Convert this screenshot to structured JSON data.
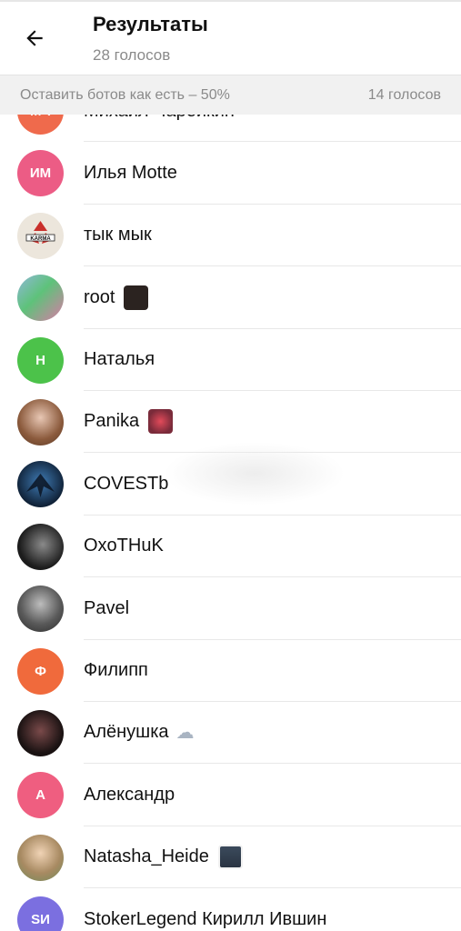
{
  "header": {
    "title": "Результаты",
    "subtitle": "28 голосов",
    "back_icon": "arrow-left-icon"
  },
  "section": {
    "option_label": "Оставить ботов как есть – 50%",
    "votes": "14 голосов"
  },
  "voters": [
    {
      "name": "Михаил Чарейкин",
      "initials": "МЧ",
      "avatar_color": "#ef6a4c",
      "avatar_type": "initials"
    },
    {
      "name": "Илья Motte",
      "initials": "ИМ",
      "avatar_color": "#ec5c85",
      "avatar_type": "initials"
    },
    {
      "name": "тык мык",
      "initials": "",
      "avatar_color": "#e9e2d6",
      "avatar_type": "image"
    },
    {
      "name": "root",
      "initials": "",
      "avatar_color": "#7aa7c9",
      "avatar_type": "image",
      "emoji": "dark-square-emoji"
    },
    {
      "name": "Наталья",
      "initials": "Н",
      "avatar_color": "#4cc24a",
      "avatar_type": "initials"
    },
    {
      "name": "Panika",
      "initials": "",
      "avatar_color": "#9c7a63",
      "avatar_type": "image",
      "emoji": "red-face-emoji"
    },
    {
      "name": "COVESTb",
      "initials": "",
      "avatar_color": "#1b3350",
      "avatar_type": "image"
    },
    {
      "name": "OxoTHuK",
      "initials": "",
      "avatar_color": "#2a2a2a",
      "avatar_type": "image"
    },
    {
      "name": "Pavel",
      "initials": "",
      "avatar_color": "#6e6e6e",
      "avatar_type": "image"
    },
    {
      "name": "Филипп",
      "initials": "Ф",
      "avatar_color": "#f06a3c",
      "avatar_type": "initials"
    },
    {
      "name": "Алёнушка",
      "initials": "",
      "avatar_color": "#3a2a2a",
      "avatar_type": "image",
      "emoji": "cloud-lightning-emoji"
    },
    {
      "name": "Александр",
      "initials": "А",
      "avatar_color": "#ef5e80",
      "avatar_type": "initials"
    },
    {
      "name": "Natasha_Heide",
      "initials": "",
      "avatar_color": "#c9b79a",
      "avatar_type": "image",
      "emoji": "cats-emoji"
    },
    {
      "name": "StokerLegend Кирилл Ившин",
      "initials": "SИ",
      "avatar_color": "#7b6fe0",
      "avatar_type": "initials"
    }
  ]
}
